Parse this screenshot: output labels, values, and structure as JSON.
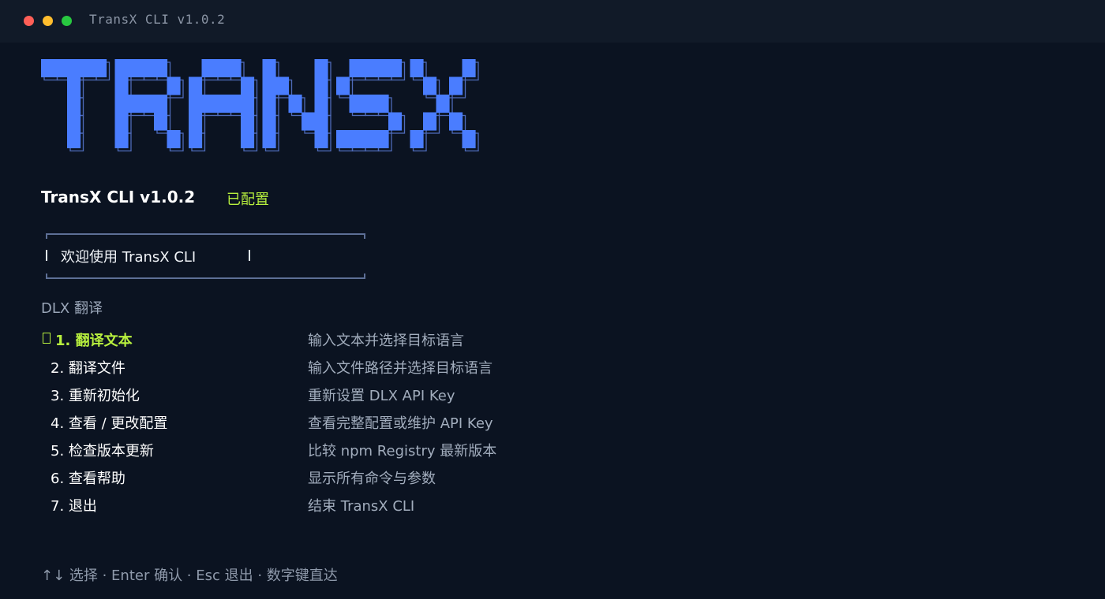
{
  "window": {
    "title": "TransX CLI v1.0.2",
    "traffic_lights": {
      "close_color": "#ff5f57",
      "minimize_color": "#ffbd2e",
      "maximize_color": "#28c840"
    }
  },
  "logo": {
    "text": "TRANSX",
    "color": "#4a7dff",
    "shadow_color": "#4e6ab8"
  },
  "header": {
    "app_version": "TransX CLI v1.0.2",
    "status": "已配置",
    "status_color": "#b8f03e"
  },
  "welcome": {
    "message": "欢迎使用 TransX CLI"
  },
  "section": {
    "label": "DLX 翻译"
  },
  "menu": {
    "selected_index": 0,
    "items": [
      {
        "label": "1. 翻译文本",
        "description": "输入文本并选择目标语言"
      },
      {
        "label": "2. 翻译文件",
        "description": "输入文件路径并选择目标语言"
      },
      {
        "label": "3. 重新初始化",
        "description": "重新设置 DLX API Key"
      },
      {
        "label": "4. 查看 / 更改配置",
        "description": "查看完整配置或维护 API Key"
      },
      {
        "label": "5. 检查版本更新",
        "description": "比较 npm Registry 最新版本"
      },
      {
        "label": "6. 查看帮助",
        "description": "显示所有命令与参数"
      },
      {
        "label": "7. 退出",
        "description": "结束 TransX CLI"
      }
    ]
  },
  "footer": {
    "hint": "↑↓ 选择 · Enter 确认 · Esc 退出 · 数字键直达"
  }
}
